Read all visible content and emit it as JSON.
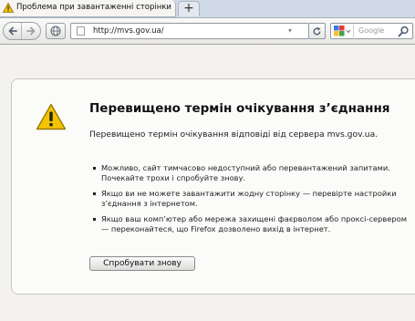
{
  "tab": {
    "title": "Проблема при завантаженні сторінки",
    "icon": "warning-icon",
    "new_tab_label": "+"
  },
  "navbar": {
    "url": "http://mvs.gov.ua/",
    "search_placeholder": "Google",
    "search_engine": "google-icon"
  },
  "error": {
    "title": "Перевищено термін очікування з’єднання",
    "description": "Перевищено термін очікування відповіді від сервера mvs.gov.ua.",
    "bullets": [
      "Можливо, сайт тимчасово недоступний або перевантажений запитами.\nПочекайте трохи і спробуйте знову.",
      "Якщо ви не можете завантажити жодну сторінку — перевірте настройки\nз’єднання з інтернетом.",
      "Якщо ваш комп’ютер або мережа захищені фаєрволом або проксі-сервером\n— переконайтеся, що Firefox дозволено вихід в інтернет."
    ],
    "retry_label": "Спробувати знову"
  },
  "colors": {
    "warning_yellow": "#f5c400",
    "tabstrip": "#cfd9e6",
    "page_background": "#f3f2ef"
  }
}
